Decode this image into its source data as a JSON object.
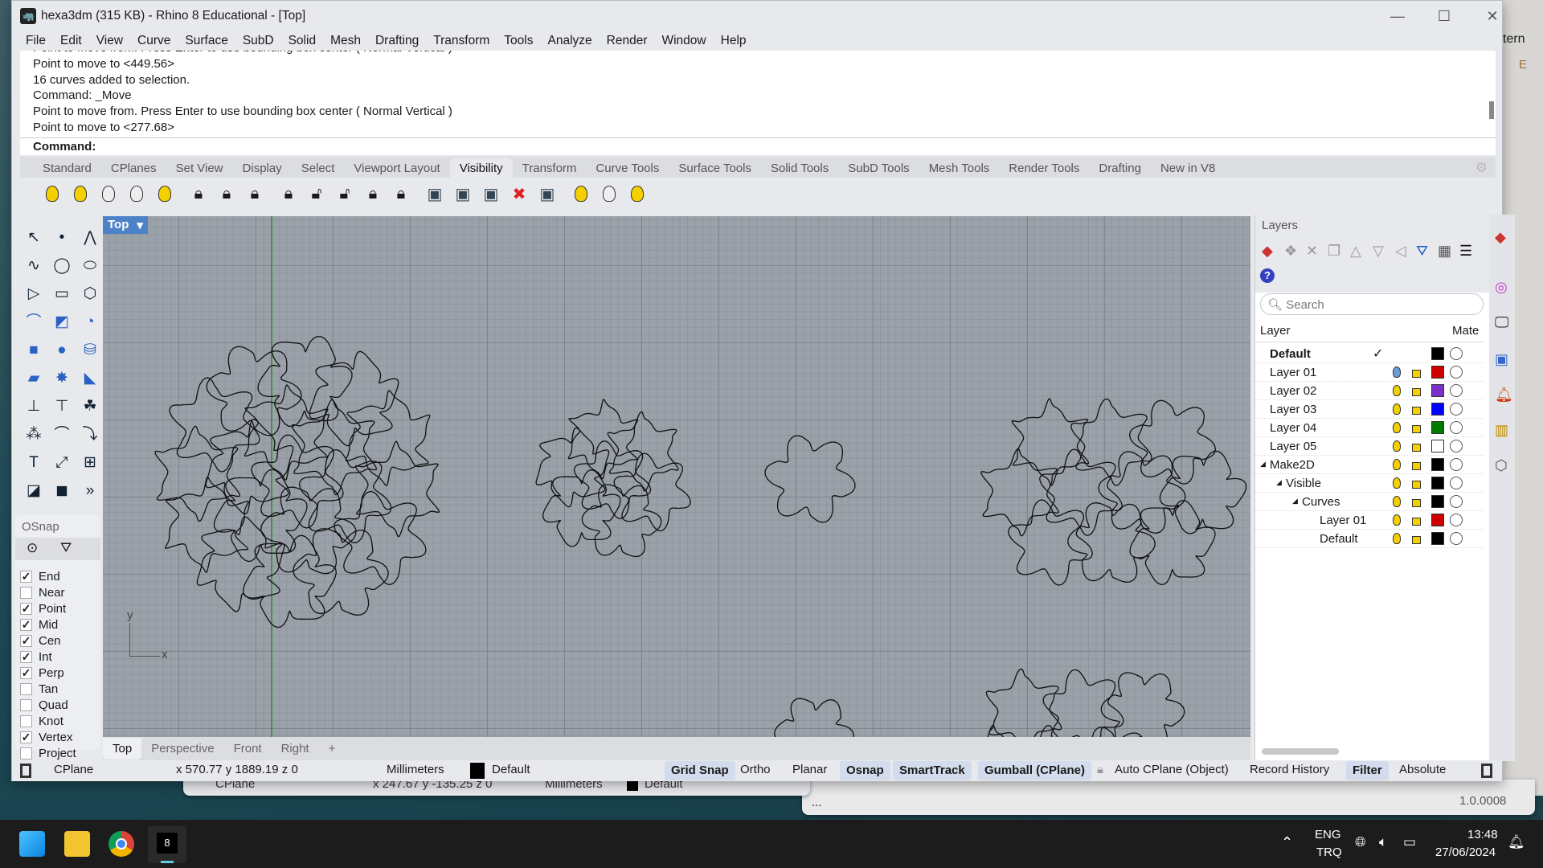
{
  "window": {
    "title": "hexa3dm (315 KB) - Rhino 8 Educational - [Top]",
    "minimize": "—",
    "maximize": "☐",
    "close": "✕"
  },
  "menu": [
    "File",
    "Edit",
    "View",
    "Curve",
    "Surface",
    "SubD",
    "Solid",
    "Mesh",
    "Drafting",
    "Transform",
    "Tools",
    "Analyze",
    "Render",
    "Window",
    "Help"
  ],
  "command_history": [
    "Point to move from. Press Enter to use bounding box center ( Normal  Vertical )",
    "Point to move to <449.56>",
    "16 curves added to selection.",
    "Command: _Move",
    "Point to move from. Press Enter to use bounding box center ( Normal  Vertical )",
    "Point to move to <277.68>"
  ],
  "command_prompt": "Command:",
  "toolbar_tabs": [
    "Standard",
    "CPlanes",
    "Set View",
    "Display",
    "Select",
    "Viewport Layout",
    "Visibility",
    "Transform",
    "Curve Tools",
    "Surface Tools",
    "Solid Tools",
    "SubD Tools",
    "Mesh Tools",
    "Render Tools",
    "Drafting",
    "New in V8"
  ],
  "active_toolbar_tab": "Visibility",
  "osnap": {
    "title": "OSnap",
    "items": [
      {
        "label": "End",
        "checked": true
      },
      {
        "label": "Near",
        "checked": false
      },
      {
        "label": "Point",
        "checked": true
      },
      {
        "label": "Mid",
        "checked": true
      },
      {
        "label": "Cen",
        "checked": true
      },
      {
        "label": "Int",
        "checked": true
      },
      {
        "label": "Perp",
        "checked": true
      },
      {
        "label": "Tan",
        "checked": false
      },
      {
        "label": "Quad",
        "checked": false
      },
      {
        "label": "Knot",
        "checked": false
      },
      {
        "label": "Vertex",
        "checked": true
      },
      {
        "label": "Project",
        "checked": false
      }
    ]
  },
  "viewport": {
    "title": "Top",
    "axis_x": "x",
    "axis_y": "y",
    "colors": {
      "background": "#9ba1a9",
      "y_axis": "#2e8b2e",
      "curves": "#111111"
    }
  },
  "viewport_tabs": [
    "Top",
    "Perspective",
    "Front",
    "Right",
    "+"
  ],
  "status": {
    "cplane": "CPlane",
    "coords": "x 570.77  y 1889.19  z 0",
    "units": "Millimeters",
    "layer": "Default",
    "grid_snap": "Grid Snap",
    "ortho": "Ortho",
    "planar": "Planar",
    "osnap": "Osnap",
    "smarttrack": "SmartTrack",
    "gumball": "Gumball (CPlane)",
    "auto_cplane": "Auto CPlane (Object)",
    "record_history": "Record History",
    "filter": "Filter",
    "absolute": "Absolute"
  },
  "layers": {
    "title": "Layers",
    "search_placeholder": "Search",
    "col_layer": "Layer",
    "col_material": "Mate",
    "rows": [
      {
        "name": "Default",
        "level": 0,
        "current": true,
        "color": "#000000",
        "bold": true
      },
      {
        "name": "Layer 01",
        "level": 0,
        "color": "#cc0000",
        "bulb": "blue"
      },
      {
        "name": "Layer 02",
        "level": 0,
        "color": "#7b2fc9"
      },
      {
        "name": "Layer 03",
        "level": 0,
        "color": "#0000ff"
      },
      {
        "name": "Layer 04",
        "level": 0,
        "color": "#007a00"
      },
      {
        "name": "Layer 05",
        "level": 0,
        "color": "#ffffff"
      },
      {
        "name": "Make2D",
        "level": 0,
        "expand": "◢",
        "color": "#000000"
      },
      {
        "name": "Visible",
        "level": 1,
        "expand": "◢",
        "color": "#000000"
      },
      {
        "name": "Curves",
        "level": 2,
        "expand": "◢",
        "color": "#000000"
      },
      {
        "name": "Layer 01",
        "level": 3,
        "color": "#cc0000"
      },
      {
        "name": "Default",
        "level": 3,
        "color": "#000000"
      }
    ]
  },
  "background_window": {
    "cplane": "CPlane",
    "coords": "x 247.67  y -135.25  z 0",
    "units": "Millimeters",
    "layer": "Default",
    "version": "1.0.0008",
    "ellipsis": "...",
    "edge_text": "tern",
    "edge_letter": "E"
  },
  "taskbar": {
    "lang1": "ENG",
    "lang2": "TRQ",
    "time": "13:48",
    "date": "27/06/2024"
  }
}
